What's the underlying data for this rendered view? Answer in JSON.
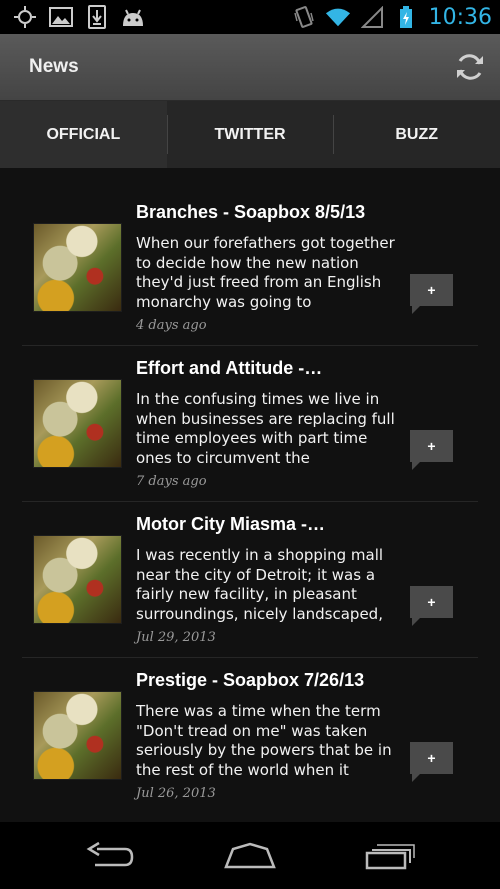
{
  "status_bar": {
    "time": "10:36",
    "icons": [
      "gps-icon",
      "image-icon",
      "download-icon",
      "android-icon",
      "vibrate-icon",
      "wifi-icon",
      "signal-icon",
      "battery-icon"
    ],
    "accent_color": "#33b5e5"
  },
  "action_bar": {
    "title": "News",
    "refresh_icon": "refresh-icon"
  },
  "tabs": [
    {
      "label": "OFFICIAL",
      "selected": true
    },
    {
      "label": "TWITTER",
      "selected": false
    },
    {
      "label": "BUZZ",
      "selected": false
    }
  ],
  "news": [
    {
      "title": "Branches - Soapbox 8/5/13",
      "excerpt": "When our forefathers got together to decide how the new nation they'd just freed from an English monarchy was going to",
      "date": "4 days ago",
      "button_label": "+"
    },
    {
      "title": "Effort and Attitude -…",
      "excerpt": "In the confusing times we live in when businesses are replacing full time employees with part time ones to circumvent the",
      "date": "7 days ago",
      "button_label": "+"
    },
    {
      "title": "Motor City Miasma -…",
      "excerpt": "I was recently in a shopping mall near the city of Detroit; it was a fairly new facility, in pleasant surroundings, nicely landscaped,",
      "date": "Jul 29, 2013",
      "button_label": "+"
    },
    {
      "title": "Prestige - Soapbox 7/26/13",
      "excerpt": "There was a time when the term \"Don't tread on me\" was taken seriously by the powers that be in the rest of the world when it",
      "date": "Jul 26, 2013",
      "button_label": "+"
    }
  ],
  "nav_bar": {
    "buttons": [
      "back-icon",
      "home-icon",
      "recent-apps-icon"
    ]
  }
}
